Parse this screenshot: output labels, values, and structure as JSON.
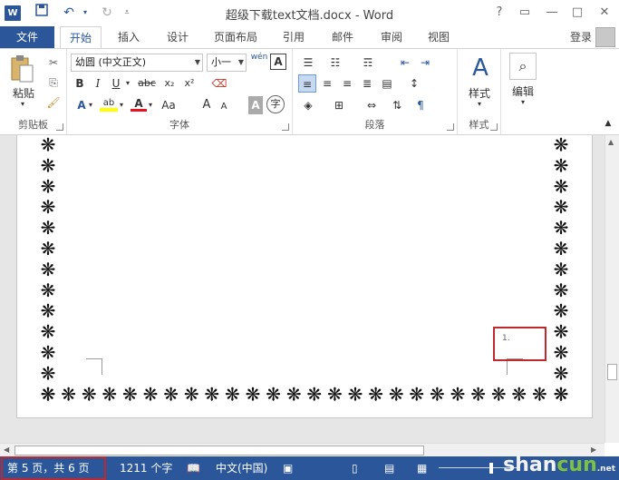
{
  "titlebar": {
    "title": "超级下载text文档.docx - Word",
    "logo": "W",
    "help": "?",
    "restore_ribbon": "▭",
    "minimize": "—",
    "maximize": "□",
    "close": "✕"
  },
  "tabs": {
    "file": "文件",
    "home": "开始",
    "insert": "插入",
    "design": "设计",
    "layout": "页面布局",
    "references": "引用",
    "mailings": "邮件",
    "review": "审阅",
    "view": "视图",
    "login": "登录"
  },
  "ribbon": {
    "clipboard": {
      "paste": "粘贴",
      "label": "剪贴板"
    },
    "font": {
      "font_name": "幼圆 (中文正文)",
      "font_size": "小一",
      "wen": "wén",
      "bold": "B",
      "italic": "I",
      "underline": "U",
      "strike": "abc",
      "subscript": "x₂",
      "superscript": "x²",
      "grow": "A",
      "shrink": "A",
      "case": "Aa",
      "label": "字体"
    },
    "paragraph": {
      "label": "段落"
    },
    "styles": {
      "button": "样式",
      "label": "样式"
    },
    "editing": {
      "button": "编辑"
    }
  },
  "document": {
    "page_number": "1.",
    "border_glyph": "❋"
  },
  "statusbar": {
    "page_info": "第 5 页，共 6 页",
    "word_count": "1211 个字",
    "language": "中文(中国)"
  },
  "watermark": {
    "text_a": "shan",
    "text_b": "cun",
    "suffix": ".net"
  },
  "colors": {
    "accent": "#2b579a",
    "highlight_box": "#c0282d",
    "font_color": "#e81123",
    "highlight_color": "#ffff00"
  }
}
